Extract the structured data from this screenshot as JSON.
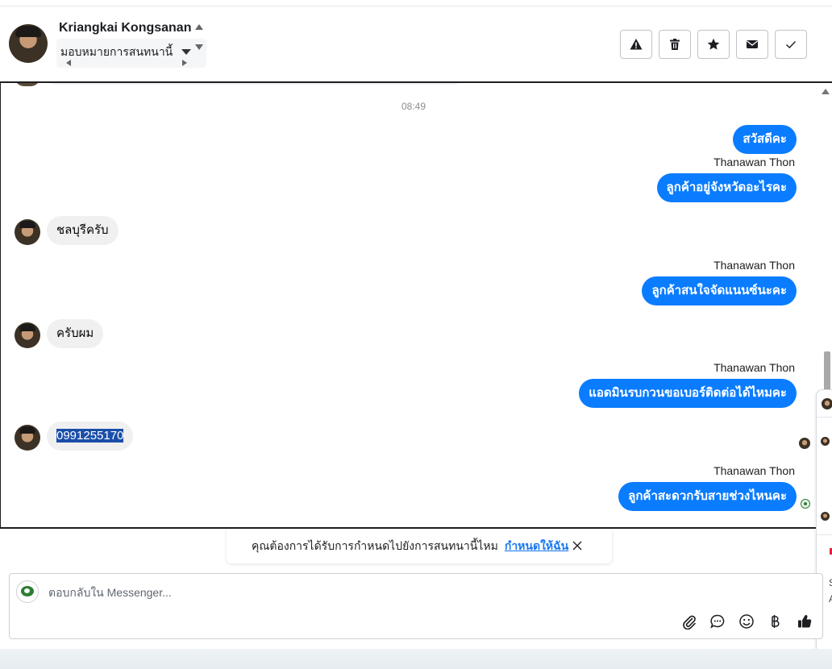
{
  "header": {
    "customer_name": "Kriangkai Kongsanan",
    "assign_label": "มอบหมายการสนทนานี้",
    "actions": [
      {
        "name": "spam-button",
        "icon": "warning-icon"
      },
      {
        "name": "delete-button",
        "icon": "trash-icon"
      },
      {
        "name": "star-button",
        "icon": "star-icon"
      },
      {
        "name": "mark-unread-button",
        "icon": "envelope-icon"
      },
      {
        "name": "mark-done-button",
        "icon": "check-icon"
      }
    ]
  },
  "thread": {
    "timestamp": "08:49",
    "messages": [
      {
        "direction": "out",
        "text": "สวัสดีคะ"
      },
      {
        "direction": "out",
        "sender": "Thanawan Thon",
        "text": "ลูกค้าอยู่จังหวัดอะไรคะ"
      },
      {
        "direction": "in",
        "text": "ชลบุรีครับ"
      },
      {
        "direction": "out",
        "sender": "Thanawan Thon",
        "text": "ลูกค้าสนใจจัดแนนซ์นะคะ"
      },
      {
        "direction": "in",
        "text": "ครับผม"
      },
      {
        "direction": "out",
        "sender": "Thanawan Thon",
        "text": "แอดมินรบกวนขอเบอร์ติดต่อได้ไหมคะ"
      },
      {
        "direction": "in",
        "text": "0991255170"
      },
      {
        "direction": "out",
        "sender": "Thanawan Thon",
        "text": "ลูกค้าสะดวกรับสายช่วงไหนคะ"
      }
    ]
  },
  "side_panel": {
    "letter_s": "S",
    "letter_a": "A"
  },
  "toast": {
    "text": "คุณต้องการได้รับการกำหนดไปยังการสนทนานี้ไหม",
    "link": "กำหนดให้ฉัน"
  },
  "composer": {
    "placeholder": "ตอบกลับใน Messenger...",
    "value": "",
    "tools": [
      "attach-icon",
      "saved-reply-icon",
      "emoji-icon",
      "baht-icon",
      "thumbs-up-icon"
    ]
  },
  "colors": {
    "outgoing_bubble": "#0a7cff",
    "incoming_bubble": "#f0f0f0",
    "link": "#1877f2",
    "highlight": "#1a4ea8"
  }
}
